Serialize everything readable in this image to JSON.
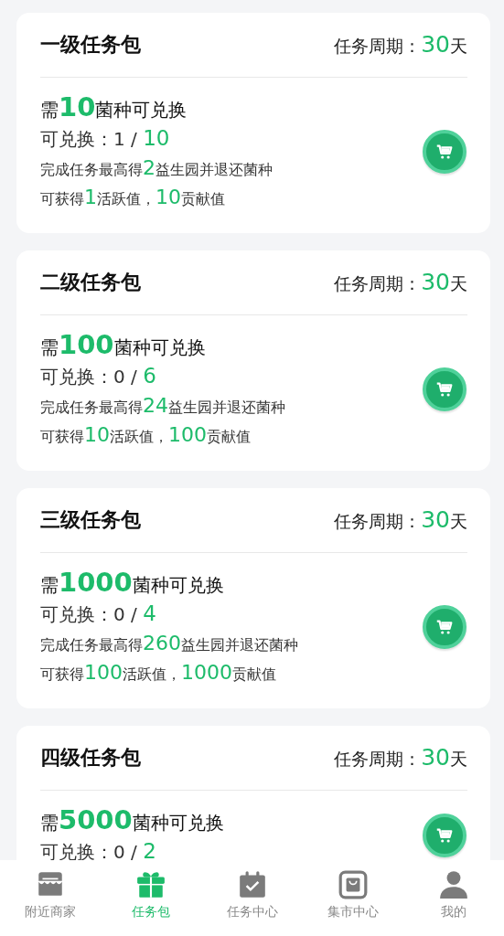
{
  "packages": [
    {
      "title": "一级任务包",
      "period": [
        {
          "text": "任务周期：",
          "highlight": false
        },
        {
          "text": "30",
          "highlight": true
        },
        {
          "text": "天",
          "highlight": false
        }
      ],
      "lines": [
        [
          {
            "text": "需",
            "highlight": false
          },
          {
            "text": "10",
            "highlight": true
          },
          {
            "text": "菌种可兑换",
            "highlight": false
          }
        ],
        [
          {
            "text": "可兑换：1 / ",
            "highlight": false
          },
          {
            "text": "10",
            "highlight": true
          }
        ],
        [
          {
            "text": "完成任务最高得",
            "highlight": false
          },
          {
            "text": "2",
            "highlight": true
          },
          {
            "text": "益生园并退还菌种",
            "highlight": false
          }
        ],
        [
          {
            "text": "可获得",
            "highlight": false
          },
          {
            "text": "1",
            "highlight": true
          },
          {
            "text": "活跃值，",
            "highlight": false
          },
          {
            "text": "10",
            "highlight": true
          },
          {
            "text": "贡献值",
            "highlight": false
          }
        ]
      ]
    },
    {
      "title": "二级任务包",
      "period": [
        {
          "text": "任务周期：",
          "highlight": false
        },
        {
          "text": "30",
          "highlight": true
        },
        {
          "text": "天",
          "highlight": false
        }
      ],
      "lines": [
        [
          {
            "text": "需",
            "highlight": false
          },
          {
            "text": "100",
            "highlight": true
          },
          {
            "text": "菌种可兑换",
            "highlight": false
          }
        ],
        [
          {
            "text": "可兑换：0 / ",
            "highlight": false
          },
          {
            "text": "6",
            "highlight": true
          }
        ],
        [
          {
            "text": "完成任务最高得",
            "highlight": false
          },
          {
            "text": "24",
            "highlight": true
          },
          {
            "text": "益生园并退还菌种",
            "highlight": false
          }
        ],
        [
          {
            "text": "可获得",
            "highlight": false
          },
          {
            "text": "10",
            "highlight": true
          },
          {
            "text": "活跃值，",
            "highlight": false
          },
          {
            "text": "100",
            "highlight": true
          },
          {
            "text": "贡献值",
            "highlight": false
          }
        ]
      ]
    },
    {
      "title": "三级任务包",
      "period": [
        {
          "text": "任务周期：",
          "highlight": false
        },
        {
          "text": "30",
          "highlight": true
        },
        {
          "text": "天",
          "highlight": false
        }
      ],
      "lines": [
        [
          {
            "text": "需",
            "highlight": false
          },
          {
            "text": "1000",
            "highlight": true
          },
          {
            "text": "菌种可兑换",
            "highlight": false
          }
        ],
        [
          {
            "text": "可兑换：0 / ",
            "highlight": false
          },
          {
            "text": "4",
            "highlight": true
          }
        ],
        [
          {
            "text": "完成任务最高得",
            "highlight": false
          },
          {
            "text": "260",
            "highlight": true
          },
          {
            "text": "益生园并退还菌种",
            "highlight": false
          }
        ],
        [
          {
            "text": "可获得",
            "highlight": false
          },
          {
            "text": "100",
            "highlight": true
          },
          {
            "text": "活跃值，",
            "highlight": false
          },
          {
            "text": "1000",
            "highlight": true
          },
          {
            "text": "贡献值",
            "highlight": false
          }
        ]
      ]
    },
    {
      "title": "四级任务包",
      "period": [
        {
          "text": "任务周期：",
          "highlight": false
        },
        {
          "text": "30",
          "highlight": true
        },
        {
          "text": "天",
          "highlight": false
        }
      ],
      "lines": [
        [
          {
            "text": "需",
            "highlight": false
          },
          {
            "text": "5000",
            "highlight": true
          },
          {
            "text": "菌种可兑换",
            "highlight": false
          }
        ],
        [
          {
            "text": "可兑换：0 / ",
            "highlight": false
          },
          {
            "text": "2",
            "highlight": true
          }
        ]
      ]
    }
  ],
  "tab_bar": [
    {
      "label": "附近商家",
      "kind": "store",
      "selected": false
    },
    {
      "label": "任务包",
      "kind": "gift",
      "selected": true
    },
    {
      "label": "任务中心",
      "kind": "calendar",
      "selected": false
    },
    {
      "label": "集市中心",
      "kind": "bag",
      "selected": false
    },
    {
      "label": "我的",
      "kind": "person",
      "selected": false
    }
  ]
}
